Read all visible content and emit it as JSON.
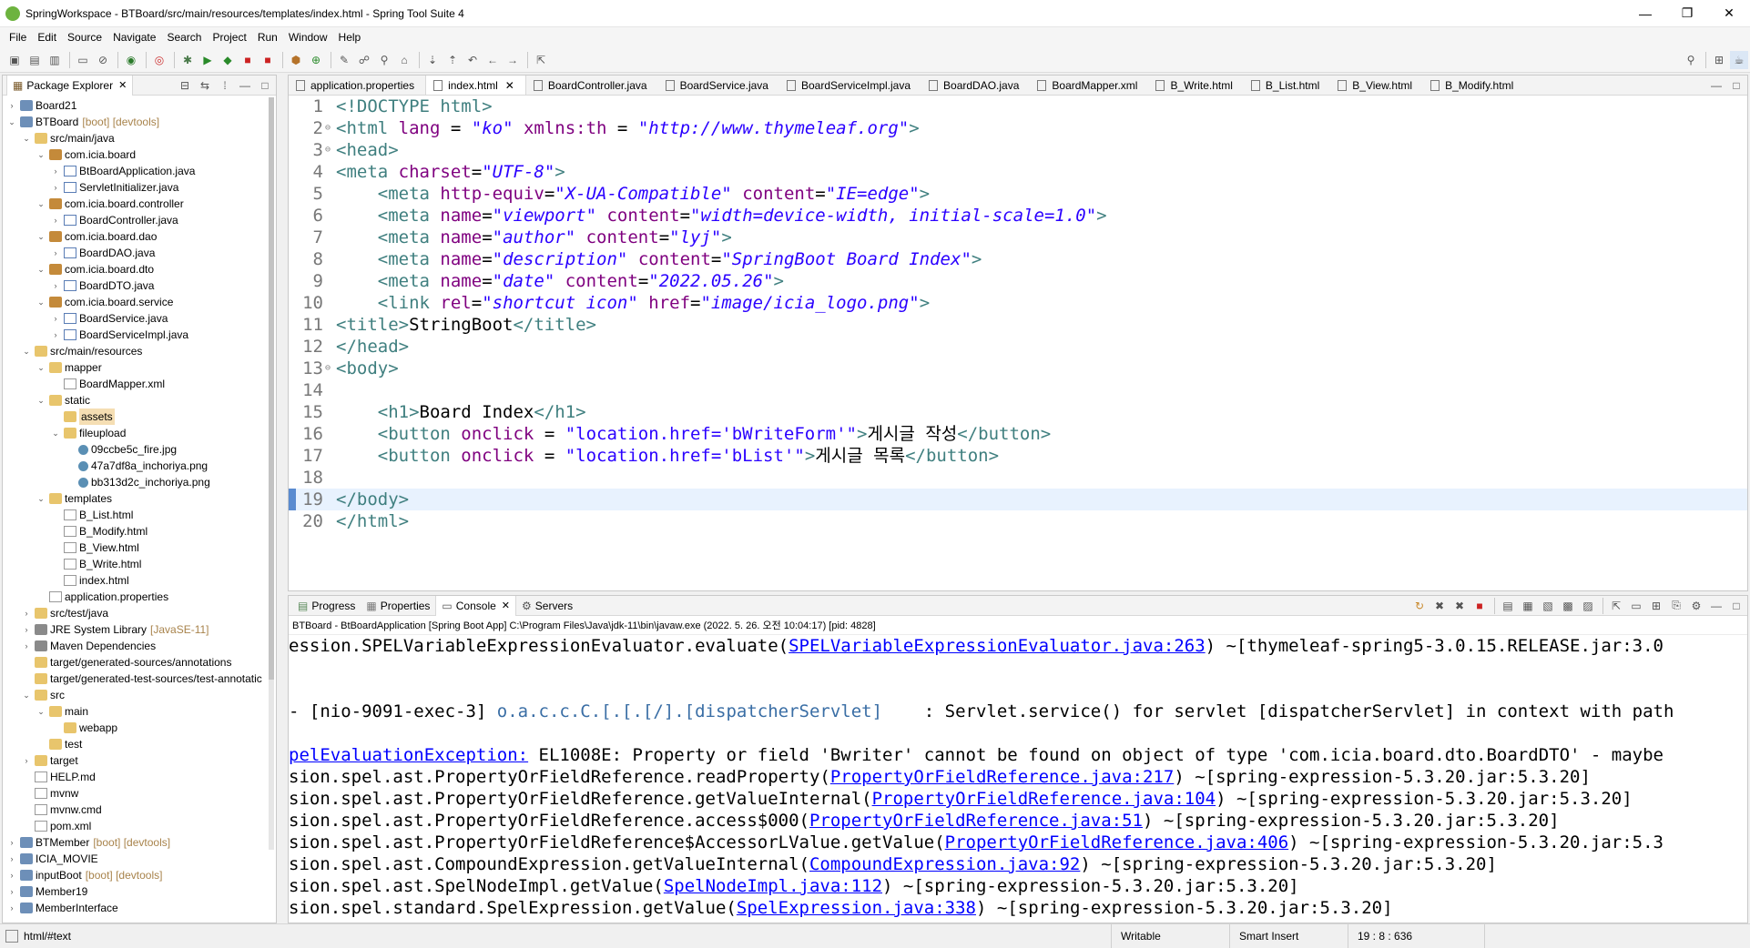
{
  "window": {
    "title": "SpringWorkspace - BTBoard/src/main/resources/templates/index.html - Spring Tool Suite 4",
    "minimize": "—",
    "maximize": "❐",
    "close": "✕"
  },
  "menu": [
    "File",
    "Edit",
    "Source",
    "Navigate",
    "Search",
    "Project",
    "Run",
    "Window",
    "Help"
  ],
  "explorer": {
    "tab_label": "Package Explorer",
    "tree": [
      {
        "indent": 0,
        "twisty": "›",
        "icon": "proj",
        "label": "Board21"
      },
      {
        "indent": 0,
        "twisty": "⌄",
        "icon": "proj",
        "label": "BTBoard",
        "deco": "[boot] [devtools]"
      },
      {
        "indent": 1,
        "twisty": "⌄",
        "icon": "folder",
        "label": "src/main/java"
      },
      {
        "indent": 2,
        "twisty": "⌄",
        "icon": "pkg",
        "label": "com.icia.board"
      },
      {
        "indent": 3,
        "twisty": "›",
        "icon": "java",
        "label": "BtBoardApplication.java"
      },
      {
        "indent": 3,
        "twisty": "›",
        "icon": "java",
        "label": "ServletInitializer.java"
      },
      {
        "indent": 2,
        "twisty": "⌄",
        "icon": "pkg",
        "label": "com.icia.board.controller"
      },
      {
        "indent": 3,
        "twisty": "›",
        "icon": "java",
        "label": "BoardController.java"
      },
      {
        "indent": 2,
        "twisty": "⌄",
        "icon": "pkg",
        "label": "com.icia.board.dao"
      },
      {
        "indent": 3,
        "twisty": "›",
        "icon": "java",
        "label": "BoardDAO.java"
      },
      {
        "indent": 2,
        "twisty": "⌄",
        "icon": "pkg",
        "label": "com.icia.board.dto"
      },
      {
        "indent": 3,
        "twisty": "›",
        "icon": "java",
        "label": "BoardDTO.java"
      },
      {
        "indent": 2,
        "twisty": "⌄",
        "icon": "pkg",
        "label": "com.icia.board.service"
      },
      {
        "indent": 3,
        "twisty": "›",
        "icon": "java",
        "label": "BoardService.java"
      },
      {
        "indent": 3,
        "twisty": "›",
        "icon": "java",
        "label": "BoardServiceImpl.java"
      },
      {
        "indent": 1,
        "twisty": "⌄",
        "icon": "folder",
        "label": "src/main/resources"
      },
      {
        "indent": 2,
        "twisty": "⌄",
        "icon": "folder",
        "label": "mapper"
      },
      {
        "indent": 3,
        "twisty": "",
        "icon": "file",
        "label": "BoardMapper.xml"
      },
      {
        "indent": 2,
        "twisty": "⌄",
        "icon": "folder",
        "label": "static"
      },
      {
        "indent": 3,
        "twisty": "",
        "icon": "folder",
        "label": "assets",
        "selected": true
      },
      {
        "indent": 3,
        "twisty": "⌄",
        "icon": "folder",
        "label": "fileupload"
      },
      {
        "indent": 4,
        "twisty": "",
        "icon": "img",
        "label": "09ccbe5c_fire.jpg"
      },
      {
        "indent": 4,
        "twisty": "",
        "icon": "img",
        "label": "47a7df8a_inchoriya.png"
      },
      {
        "indent": 4,
        "twisty": "",
        "icon": "img",
        "label": "bb313d2c_inchoriya.png"
      },
      {
        "indent": 2,
        "twisty": "⌄",
        "icon": "folder",
        "label": "templates"
      },
      {
        "indent": 3,
        "twisty": "",
        "icon": "file",
        "label": "B_List.html"
      },
      {
        "indent": 3,
        "twisty": "",
        "icon": "file",
        "label": "B_Modify.html"
      },
      {
        "indent": 3,
        "twisty": "",
        "icon": "file",
        "label": "B_View.html"
      },
      {
        "indent": 3,
        "twisty": "",
        "icon": "file",
        "label": "B_Write.html"
      },
      {
        "indent": 3,
        "twisty": "",
        "icon": "file",
        "label": "index.html"
      },
      {
        "indent": 2,
        "twisty": "",
        "icon": "file",
        "label": "application.properties"
      },
      {
        "indent": 1,
        "twisty": "›",
        "icon": "folder",
        "label": "src/test/java"
      },
      {
        "indent": 1,
        "twisty": "›",
        "icon": "lib",
        "label": "JRE System Library",
        "deco": "[JavaSE-11]"
      },
      {
        "indent": 1,
        "twisty": "›",
        "icon": "lib",
        "label": "Maven Dependencies"
      },
      {
        "indent": 1,
        "twisty": "",
        "icon": "folder",
        "label": "target/generated-sources/annotations"
      },
      {
        "indent": 1,
        "twisty": "",
        "icon": "folder",
        "label": "target/generated-test-sources/test-annotatic"
      },
      {
        "indent": 1,
        "twisty": "⌄",
        "icon": "folder",
        "label": "src"
      },
      {
        "indent": 2,
        "twisty": "⌄",
        "icon": "folder",
        "label": "main"
      },
      {
        "indent": 3,
        "twisty": "",
        "icon": "folder",
        "label": "webapp"
      },
      {
        "indent": 2,
        "twisty": "",
        "icon": "folder",
        "label": "test"
      },
      {
        "indent": 1,
        "twisty": "›",
        "icon": "folder",
        "label": "target"
      },
      {
        "indent": 1,
        "twisty": "",
        "icon": "file",
        "label": "HELP.md"
      },
      {
        "indent": 1,
        "twisty": "",
        "icon": "file",
        "label": "mvnw"
      },
      {
        "indent": 1,
        "twisty": "",
        "icon": "file",
        "label": "mvnw.cmd"
      },
      {
        "indent": 1,
        "twisty": "",
        "icon": "file",
        "label": "pom.xml"
      },
      {
        "indent": 0,
        "twisty": "›",
        "icon": "proj",
        "label": "BTMember",
        "deco": "[boot] [devtools]"
      },
      {
        "indent": 0,
        "twisty": "›",
        "icon": "proj",
        "label": "ICIA_MOVIE"
      },
      {
        "indent": 0,
        "twisty": "›",
        "icon": "proj",
        "label": "inputBoot",
        "deco": "[boot] [devtools]"
      },
      {
        "indent": 0,
        "twisty": "›",
        "icon": "proj",
        "label": "Member19"
      },
      {
        "indent": 0,
        "twisty": "›",
        "icon": "proj",
        "label": "MemberInterface"
      }
    ]
  },
  "editor": {
    "tabs": [
      {
        "label": "application.properties",
        "active": false
      },
      {
        "label": "index.html",
        "active": true
      },
      {
        "label": "BoardController.java",
        "active": false
      },
      {
        "label": "BoardService.java",
        "active": false
      },
      {
        "label": "BoardServiceImpl.java",
        "active": false
      },
      {
        "label": "BoardDAO.java",
        "active": false
      },
      {
        "label": "BoardMapper.xml",
        "active": false
      },
      {
        "label": "B_Write.html",
        "active": false
      },
      {
        "label": "B_List.html",
        "active": false
      },
      {
        "label": "B_View.html",
        "active": false
      },
      {
        "label": "B_Modify.html",
        "active": false
      }
    ],
    "lines": [
      {
        "n": "1",
        "fold": "",
        "html": "<span class='tg'>&lt;!DOCTYPE html&gt;</span>"
      },
      {
        "n": "2",
        "fold": "⊖",
        "html": "<span class='tg'>&lt;html</span> <span class='at'>lang</span> = <span class='st'>\"ko\"</span> <span class='at'>xmlns:th</span> = <span class='st'>\"http://www.thymeleaf.org\"</span><span class='tg'>&gt;</span>"
      },
      {
        "n": "3",
        "fold": "⊖",
        "html": "<span class='tg'>&lt;head&gt;</span>"
      },
      {
        "n": "4",
        "fold": "",
        "html": "<span class='tg'>&lt;meta</span> <span class='at'>charset</span>=<span class='st'>\"UTF-8\"</span><span class='tg'>&gt;</span>"
      },
      {
        "n": "5",
        "fold": "",
        "html": "    <span class='tg'>&lt;meta</span> <span class='at'>http-equiv</span>=<span class='st'>\"X-UA-Compatible\"</span> <span class='at'>content</span>=<span class='st'>\"IE=edge\"</span><span class='tg'>&gt;</span>"
      },
      {
        "n": "6",
        "fold": "",
        "html": "    <span class='tg'>&lt;meta</span> <span class='at'>name</span>=<span class='st'>\"viewport\"</span> <span class='at'>content</span>=<span class='st'>\"width=device-width, initial-scale=1.0\"</span><span class='tg'>&gt;</span>"
      },
      {
        "n": "7",
        "fold": "",
        "html": "    <span class='tg'>&lt;meta</span> <span class='at'>name</span>=<span class='st'>\"author\"</span> <span class='at'>content</span>=<span class='st'>\"lyj\"</span><span class='tg'>&gt;</span>"
      },
      {
        "n": "8",
        "fold": "",
        "html": "    <span class='tg'>&lt;meta</span> <span class='at'>name</span>=<span class='st'>\"description\"</span> <span class='at'>content</span>=<span class='st'>\"SpringBoot Board Index\"</span><span class='tg'>&gt;</span>"
      },
      {
        "n": "9",
        "fold": "",
        "html": "    <span class='tg'>&lt;meta</span> <span class='at'>name</span>=<span class='st'>\"date\"</span> <span class='at'>content</span>=<span class='st'>\"2022.05.26\"</span><span class='tg'>&gt;</span>"
      },
      {
        "n": "10",
        "fold": "",
        "html": "    <span class='tg'>&lt;link</span> <span class='at'>rel</span>=<span class='st'>\"shortcut icon\"</span> <span class='at'>href</span>=<span class='st'>\"image/icia_logo.png\"</span><span class='tg'>&gt;</span>"
      },
      {
        "n": "11",
        "fold": "",
        "html": "<span class='tg'>&lt;title&gt;</span>StringBoot<span class='tg'>&lt;/title&gt;</span>"
      },
      {
        "n": "12",
        "fold": "",
        "html": "<span class='tg'>&lt;/head&gt;</span>"
      },
      {
        "n": "13",
        "fold": "⊖",
        "html": "<span class='tg'>&lt;body&gt;</span>"
      },
      {
        "n": "14",
        "fold": "",
        "html": ""
      },
      {
        "n": "15",
        "fold": "",
        "html": "    <span class='tg'>&lt;h1&gt;</span>Board Index<span class='tg'>&lt;/h1&gt;</span>"
      },
      {
        "n": "16",
        "fold": "",
        "html": "    <span class='tg'>&lt;button</span> <span class='at'>onclick</span> = <span class='st' style='font-style:normal'>\"location.href='bWriteForm'\"</span><span class='tg'>&gt;</span>게시글 작성<span class='tg'>&lt;/button&gt;</span>"
      },
      {
        "n": "17",
        "fold": "",
        "html": "    <span class='tg'>&lt;button</span> <span class='at'>onclick</span> = <span class='st' style='font-style:normal'>\"location.href='bList'\"</span><span class='tg'>&gt;</span>게시글 목록<span class='tg'>&lt;/button&gt;</span>"
      },
      {
        "n": "18",
        "fold": "",
        "html": ""
      },
      {
        "n": "19",
        "fold": "",
        "html": "<span class='tg'>&lt;/body&gt;</span>",
        "current": true
      },
      {
        "n": "20",
        "fold": "",
        "html": "<span class='tg'>&lt;/html&gt;</span>"
      }
    ]
  },
  "console": {
    "tabs": [
      "Progress",
      "Properties",
      "Console",
      "Servers"
    ],
    "header": "BTBoard - BtBoardApplication [Spring Boot App] C:\\Program Files\\Java\\jdk-11\\bin\\javaw.exe  (2022. 5. 26. 오전 10:04:17) [pid: 4828]",
    "lines": [
      {
        "html": "ession.SPELVariableExpressionEvaluator.evaluate(<span class='lnk'>SPELVariableExpressionEvaluator.java:263</span>) ~[thymeleaf-spring5-3.0.15.RELEASE.jar:3.0"
      },
      {
        "html": ""
      },
      {
        "html": ""
      },
      {
        "html": "- [nio-9091-exec-3] <span class='lnk2'>o.a.c.c.C.[.[.[/].[dispatcherServlet]</span>    : Servlet.service() for servlet [dispatcherServlet] in context with path"
      },
      {
        "html": ""
      },
      {
        "html": "<span class='lnk'>pelEvaluationException:</span> EL1008E: Property or field 'Bwriter' cannot be found on object of type 'com.icia.board.dto.BoardDTO' - maybe"
      },
      {
        "html": "sion.spel.ast.PropertyOrFieldReference.readProperty(<span class='lnk'>PropertyOrFieldReference.java:217</span>) ~[spring-expression-5.3.20.jar:5.3.20]"
      },
      {
        "html": "sion.spel.ast.PropertyOrFieldReference.getValueInternal(<span class='lnk'>PropertyOrFieldReference.java:104</span>) ~[spring-expression-5.3.20.jar:5.3.20]"
      },
      {
        "html": "sion.spel.ast.PropertyOrFieldReference.access$000(<span class='lnk'>PropertyOrFieldReference.java:51</span>) ~[spring-expression-5.3.20.jar:5.3.20]"
      },
      {
        "html": "sion.spel.ast.PropertyOrFieldReference$AccessorLValue.getValue(<span class='lnk'>PropertyOrFieldReference.java:406</span>) ~[spring-expression-5.3.20.jar:5.3"
      },
      {
        "html": "sion.spel.ast.CompoundExpression.getValueInternal(<span class='lnk'>CompoundExpression.java:92</span>) ~[spring-expression-5.3.20.jar:5.3.20]"
      },
      {
        "html": "sion.spel.ast.SpelNodeImpl.getValue(<span class='lnk'>SpelNodeImpl.java:112</span>) ~[spring-expression-5.3.20.jar:5.3.20]"
      },
      {
        "html": "sion.spel.standard.SpelExpression.getValue(<span class='lnk'>SpelExpression.java:338</span>) ~[spring-expression-5.3.20.jar:5.3.20]"
      }
    ]
  },
  "status": {
    "path": "html/#text",
    "writable": "Writable",
    "insert_mode": "Smart Insert",
    "position": "19 : 8 : 636"
  }
}
